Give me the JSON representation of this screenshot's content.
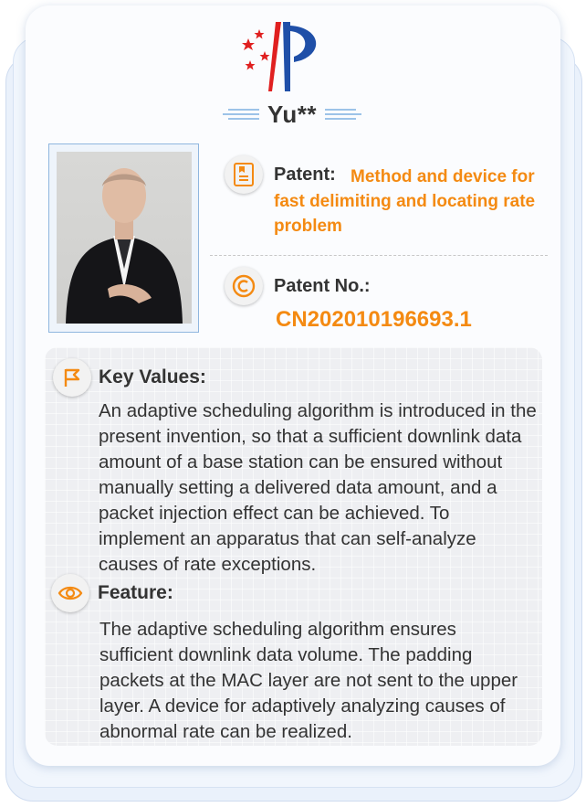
{
  "header": {
    "name": "Yu**"
  },
  "patent": {
    "label": "Patent:",
    "title": "Method and device for fast delimiting and locating rate problem",
    "number_label": "Patent No.:",
    "number": "CN202010196693.1"
  },
  "key_values": {
    "title": "Key Values:",
    "text": "An adaptive scheduling algorithm is introduced in the present invention, so that a sufficient downlink data amount of a base station can be ensured without manually setting a delivered data amount, and a packet injection effect can be achieved. To implement an apparatus that can self-analyze causes of rate exceptions."
  },
  "feature": {
    "title": "Feature:",
    "text": "The adaptive scheduling algorithm ensures sufficient downlink data volume. The padding packets at the MAC layer are not sent to the upper layer. A device for adaptively analyzing causes of abnormal rate can be realized."
  },
  "icons": {
    "logo": "emblem-logo",
    "patent": "document-icon",
    "patent_no": "copyright-icon",
    "key_values": "flag-icon",
    "feature": "eye-icon"
  },
  "colors": {
    "accent": "#f48a12",
    "text": "#333333",
    "logo_red": "#e02020",
    "logo_blue": "#1f4fa8"
  }
}
